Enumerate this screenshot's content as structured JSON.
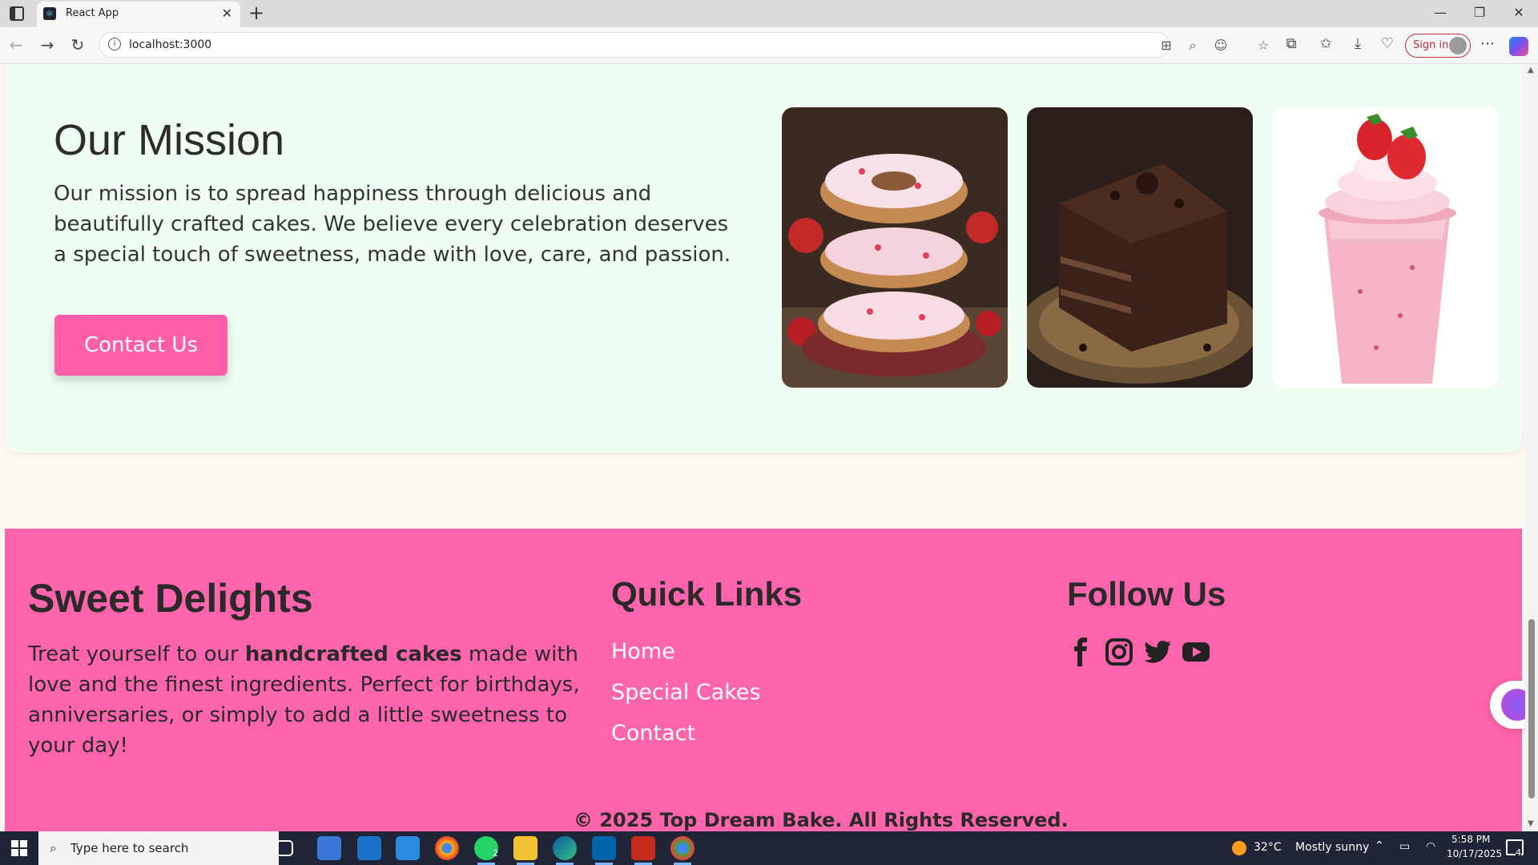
{
  "browser": {
    "tab_title": "React App",
    "url": "localhost:3000",
    "signin_label": "Sign in"
  },
  "mission": {
    "title": "Our Mission",
    "text": "Our mission is to spread happiness through delicious and beautifully crafted cakes. We believe every celebration deserves a special touch of sweetness, made with love, care, and passion.",
    "button_label": "Contact Us",
    "photos": [
      "strawberry-donuts-image",
      "chocolate-cake-image",
      "strawberry-milkshake-image"
    ]
  },
  "footer": {
    "brand_title": "Sweet Delights",
    "brand_text_before": "Treat yourself to our ",
    "brand_text_bold": "handcrafted cakes",
    "brand_text_after": " made with love and the finest ingredients. Perfect for birthdays, anniversaries, or simply to add a little sweetness to your day!",
    "links_title": "Quick Links",
    "links": [
      "Home",
      "Special Cakes",
      "Contact"
    ],
    "follow_title": "Follow Us",
    "social": [
      "facebook-icon",
      "instagram-icon",
      "twitter-icon",
      "youtube-icon"
    ],
    "copyright": "© 2025 Top Dream Bake. All Rights Reserved."
  },
  "taskbar": {
    "search_placeholder": "Type here to search",
    "weather_temp": "32°C",
    "weather_desc": "Mostly sunny",
    "time": "5:58 PM",
    "date": "10/17/2025",
    "whatsapp_badge": "2",
    "notification_count": "4"
  },
  "colors": {
    "accent_pink": "#ff64ad",
    "button_pink": "#ff5fa8",
    "mission_bg": "#effdf3",
    "page_bg": "#fff9f3"
  }
}
